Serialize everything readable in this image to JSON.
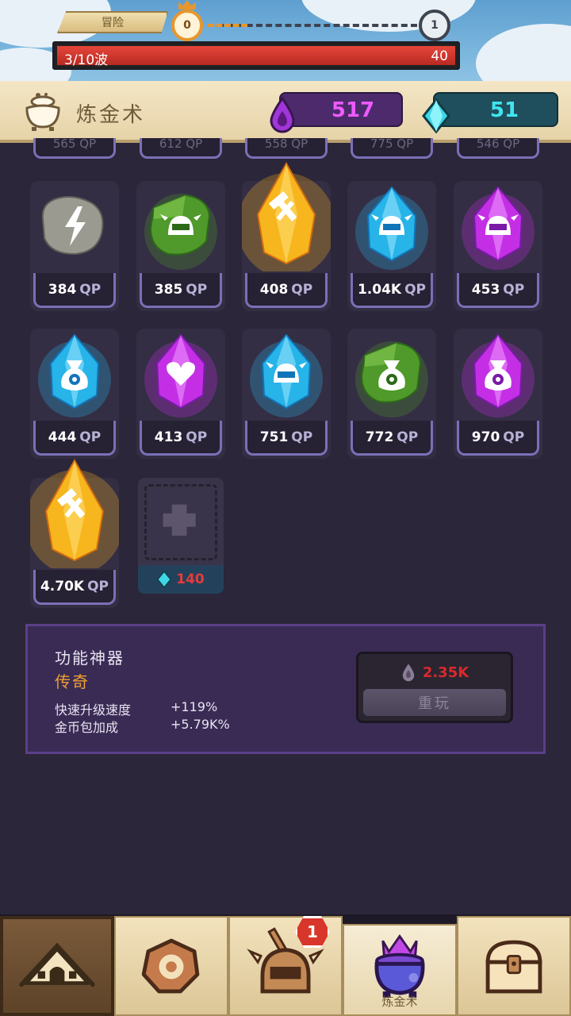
{
  "top": {
    "adventure_tab": "冒险",
    "stage_current": "0",
    "stage_next": "1",
    "wave_text": "3/10波",
    "wave_enemies": "40",
    "wave_progress": 1.0
  },
  "header": {
    "title": "炼金术",
    "elixir": "517",
    "gems": "51"
  },
  "grid": {
    "top_row_partial": [
      "565 QP",
      "612 QP",
      "558 QP",
      "775 QP",
      "546 QP"
    ],
    "rows": [
      [
        {
          "value": "384",
          "unit": "QP",
          "icon": "lightning-stone-icon",
          "color": "gray"
        },
        {
          "value": "385",
          "unit": "QP",
          "icon": "knight-helmet-icon",
          "color": "green"
        },
        {
          "value": "408",
          "unit": "QP",
          "icon": "hammer-icon",
          "color": "gold"
        },
        {
          "value": "1.04K",
          "unit": "QP",
          "icon": "knight-helmet-icon",
          "color": "blue"
        },
        {
          "value": "453",
          "unit": "QP",
          "icon": "knight-helmet-icon",
          "color": "purple"
        }
      ],
      [
        {
          "value": "444",
          "unit": "QP",
          "icon": "money-bag-icon",
          "color": "blue"
        },
        {
          "value": "413",
          "unit": "QP",
          "icon": "heart-icon",
          "color": "purple"
        },
        {
          "value": "751",
          "unit": "QP",
          "icon": "knight-helmet-icon",
          "color": "blue"
        },
        {
          "value": "772",
          "unit": "QP",
          "icon": "money-bag-icon",
          "color": "green"
        },
        {
          "value": "970",
          "unit": "QP",
          "icon": "money-bag-icon",
          "color": "purple"
        }
      ],
      [
        {
          "value": "4.70K",
          "unit": "QP",
          "icon": "hammer-icon",
          "color": "gold"
        }
      ]
    ],
    "add_slot_cost": "140"
  },
  "info": {
    "name": "功能神器",
    "rarity": "传奇",
    "stats": [
      {
        "label": "快速升级速度",
        "value": "+119%"
      },
      {
        "label": "金币包加成",
        "value": "+5.79K%"
      }
    ],
    "replay_cost": "2.35K",
    "replay_label": "重玩"
  },
  "nav": {
    "items": [
      {
        "name": "camp",
        "icon": "tent-icon",
        "label": ""
      },
      {
        "name": "relics",
        "icon": "relic-stone-icon",
        "label": ""
      },
      {
        "name": "heroes",
        "icon": "helmet-icon",
        "label": "",
        "badge": "1"
      },
      {
        "name": "alchemy",
        "icon": "cauldron-icon",
        "label": "炼金术"
      },
      {
        "name": "chest",
        "icon": "treasure-chest-icon",
        "label": ""
      }
    ]
  },
  "colors": {
    "gold": "#f7b51e",
    "blue": "#27b4e8",
    "purple": "#c42fe6",
    "green": "#4f9a2a",
    "gray": "#9a9a90",
    "elixir": "#ee5aff",
    "gem": "#3fe6f0"
  }
}
